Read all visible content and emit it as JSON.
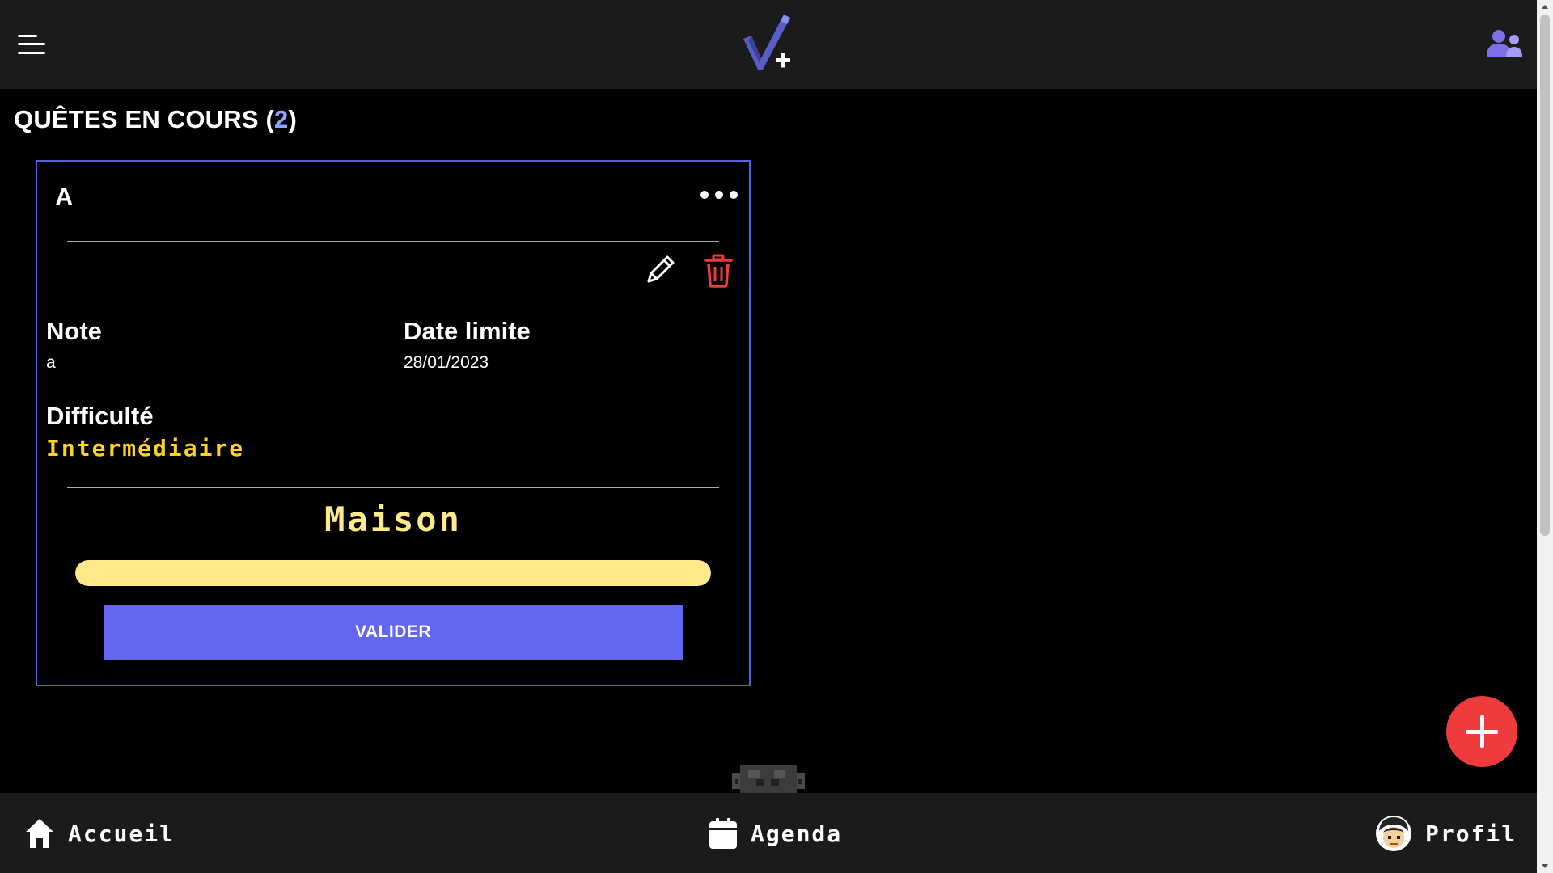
{
  "header": {
    "menu_icon": "hamburger-menu-icon",
    "logo_icon": "check-plus-logo-icon",
    "friends_icon": "users-icon"
  },
  "section": {
    "title": "QUÊTES EN COURS (",
    "count": "2",
    "title_end": ")"
  },
  "quest": {
    "title": "A",
    "more_icon": "more-horizontal-icon",
    "edit_icon": "pencil-icon",
    "delete_icon": "trash-icon",
    "note_label": "Note",
    "note_value": "a",
    "deadline_label": "Date limite",
    "deadline_value": "28/01/2023",
    "difficulty_label": "Difficulté",
    "difficulty_value": "Intermédiaire",
    "category": "Maison",
    "progress": 1.0,
    "validate_label": "VALIDER"
  },
  "fab": {
    "icon": "plus-icon"
  },
  "nav": {
    "home_label": "Accueil",
    "home_icon": "home-icon",
    "agenda_label": "Agenda",
    "agenda_icon": "calendar-icon",
    "profile_label": "Profil",
    "profile_icon": "avatar-icon"
  },
  "colors": {
    "accent": "#6366f1",
    "card_border": "#5b5fdc",
    "difficulty": "#ffd21f",
    "category": "#ffe98a",
    "fab": "#ef3b3b",
    "count": "#8fa5ff",
    "delete": "#ef3b3b"
  }
}
